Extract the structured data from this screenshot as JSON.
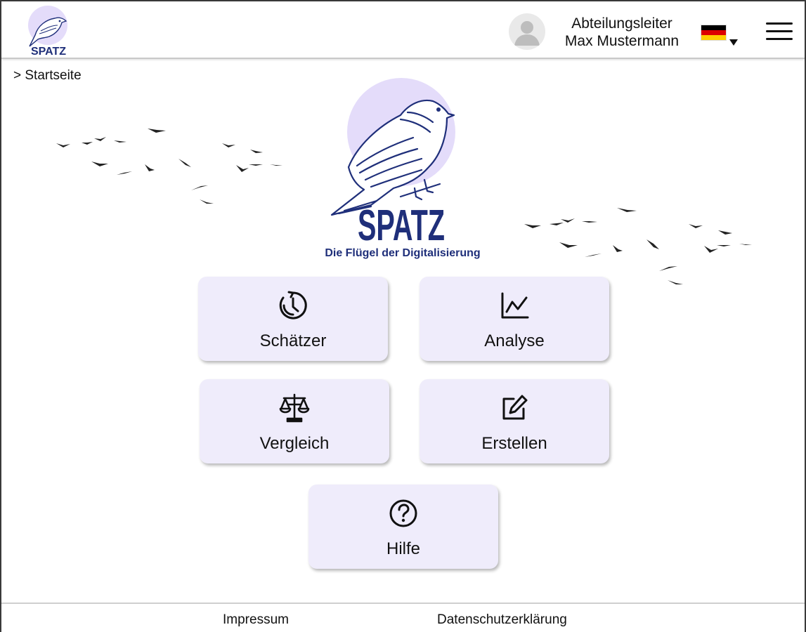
{
  "header": {
    "logo_text": "SPATZ",
    "user_role": "Abteilungsleiter",
    "user_name": "Max Mustermann",
    "language_flag": "german-flag-icon",
    "menu_icon": "hamburger-menu-icon"
  },
  "breadcrumb": {
    "text": "> Startseite"
  },
  "hero": {
    "logo_text": "SPATZ",
    "tagline": "Die Flügel der Digitalisierung"
  },
  "tiles": [
    {
      "label": "Schätzer",
      "icon": "timer-icon"
    },
    {
      "label": "Analyse",
      "icon": "line-chart-icon"
    },
    {
      "label": "Vergleich",
      "icon": "scales-icon"
    },
    {
      "label": "Erstellen",
      "icon": "edit-icon"
    },
    {
      "label": "Hilfe",
      "icon": "help-icon"
    }
  ],
  "footer": {
    "impressum": "Impressum",
    "privacy": "Datenschutzerklärung"
  },
  "colors": {
    "brand_navy": "#1f2f7a",
    "tile_bg": "#efecfb",
    "logo_circle": "#e4dcfa",
    "flag_black": "#000000",
    "flag_red": "#dd0000",
    "flag_gold": "#ffce00"
  }
}
